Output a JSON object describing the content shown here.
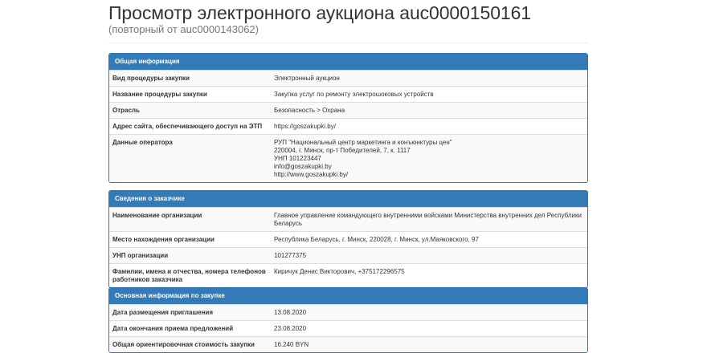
{
  "header": {
    "title": "Просмотр электронного аукциона auc0000150161",
    "subtitle": "(повторный от auc0000143062)"
  },
  "general": {
    "heading": "Общая информация",
    "rows": [
      {
        "label": "Вид процедуры закупки",
        "value": "Электронный аукцион"
      },
      {
        "label": "Название процедуры закупки",
        "value": "Закупка услуг по ремонту электрошоковых устройств"
      },
      {
        "label": "Отрасль",
        "value": "Безопасность > Охрана"
      },
      {
        "label": "Адрес сайта, обеспечивающего доступ на ЭТП",
        "value": "https://goszakupki.by/"
      }
    ],
    "operator": {
      "label": "Данные оператора",
      "lines": [
        "РУП \"Национальный центр маркетинга и конъюнктуры цен\"",
        "220004, г. Минск, пр-т Победителей, 7, к. 1117",
        "УНП 101223447",
        "info@goszakupki.by",
        "http://www.goszakupki.by/"
      ]
    }
  },
  "customer": {
    "heading": "Сведения о заказчике",
    "rows": [
      {
        "label": "Наименование организации",
        "value": "Главное управление командующего внутренними войсками Министерства внутренних дел Республики Беларусь"
      },
      {
        "label": "Место нахождения организации",
        "value": "Республика Беларусь, г. Минск, 220028, г. Минск, ул.Маяковского, 97"
      },
      {
        "label": "УНП организации",
        "value": "101277375"
      },
      {
        "label": "Фамилии, имена и отчества, номера телефонов работников заказчика",
        "value": "Киричук Денис Викторович, +375172296575"
      }
    ]
  },
  "procurement": {
    "heading": "Основная информация по закупке",
    "rows": [
      {
        "label": "Дата размещения приглашения",
        "value": "13.08.2020"
      },
      {
        "label": "Дата окончания приема предложений",
        "value": "23.08.2020"
      },
      {
        "label": "Общая ориентировочная стоимость закупки",
        "value": "16.240 BYN"
      }
    ]
  }
}
